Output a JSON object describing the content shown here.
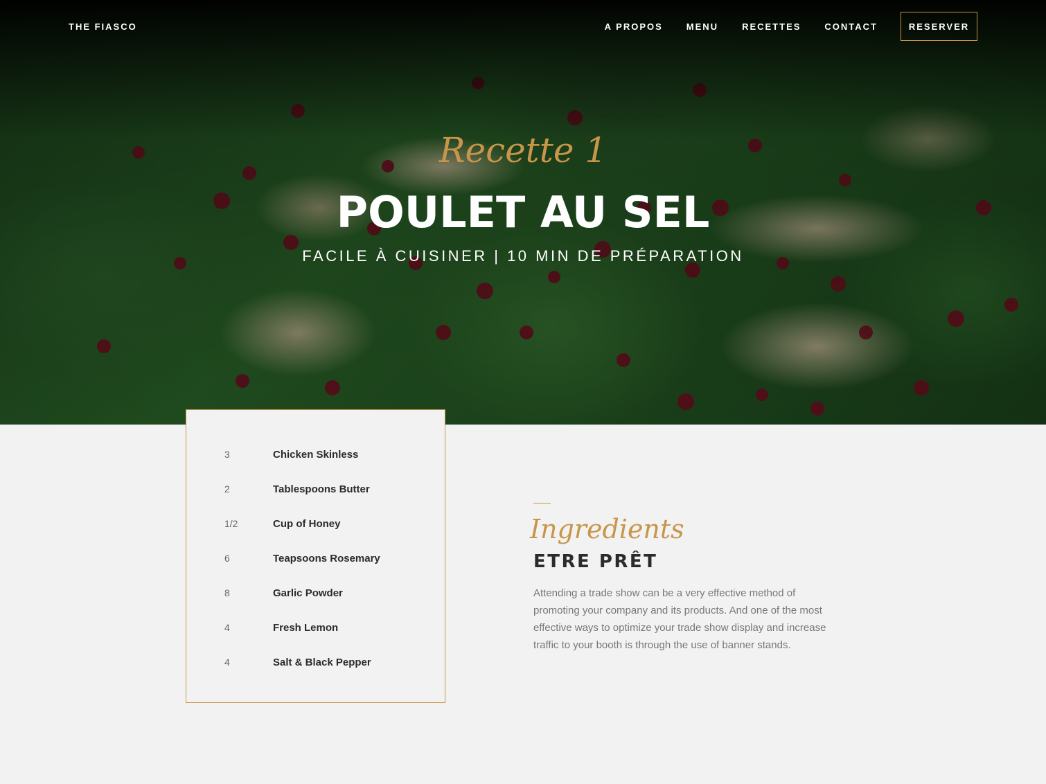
{
  "nav": {
    "brand": "THE FIASCO",
    "links": [
      "A PROPOS",
      "MENU",
      "RECETTES",
      "CONTACT"
    ],
    "reserve_label": "RESERVER"
  },
  "hero": {
    "script": "Recette 1",
    "title": "POULET AU SEL",
    "subtitle": "FACILE À CUISINER | 10 MIN DE PRÉPARATION"
  },
  "ingredients": [
    {
      "qty": "3",
      "name": "Chicken Skinless"
    },
    {
      "qty": "2",
      "name": "Tablespoons Butter"
    },
    {
      "qty": "1/2",
      "name": "Cup of Honey"
    },
    {
      "qty": "6",
      "name": "Teapsoons Rosemary"
    },
    {
      "qty": "8",
      "name": "Garlic Powder"
    },
    {
      "qty": "4",
      "name": "Fresh Lemon"
    },
    {
      "qty": "4",
      "name": "Salt & Black Pepper"
    }
  ],
  "info": {
    "script": "Ingredients",
    "heading": "ETRE PRÊT",
    "paragraph": "Attending a trade show can be a very effective method of promoting your company and its products. And one of the most effective ways to optimize your trade show display and increase traffic to your booth is through the use of banner stands."
  },
  "colors": {
    "accent": "#c8964a",
    "background": "#f2f2f2",
    "text_dark": "#2b2b2b",
    "text_muted": "#777777"
  }
}
